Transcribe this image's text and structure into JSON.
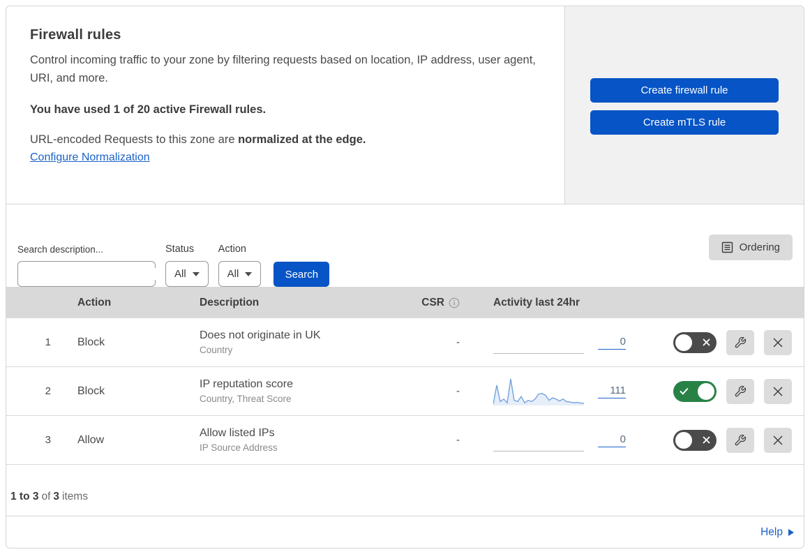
{
  "header": {
    "title": "Firewall rules",
    "description": "Control incoming traffic to your zone by filtering requests based on location, IP address, user agent, URI, and more.",
    "usage_bold": "You have used 1 of 20 active Firewall rules.",
    "normalization_prefix": "URL-encoded Requests to this zone are ",
    "normalization_bold": "normalized at the edge.",
    "normalization_link": "Configure Normalization",
    "create_firewall_button": "Create firewall rule",
    "create_mtls_button": "Create mTLS rule"
  },
  "filters": {
    "search_label": "Search description...",
    "search_value": "",
    "status_label": "Status",
    "status_value": "All",
    "action_label": "Action",
    "action_value": "All",
    "search_button": "Search",
    "ordering_button": "Ordering"
  },
  "table": {
    "columns": {
      "action": "Action",
      "description": "Description",
      "csr": "CSR",
      "activity": "Activity last 24hr"
    },
    "rows": [
      {
        "number": "1",
        "action": "Block",
        "description": "Does not originate in UK",
        "criteria": "Country",
        "csr": "-",
        "activity_count": "0",
        "enabled": false,
        "sparkline": []
      },
      {
        "number": "2",
        "action": "Block",
        "description": "IP reputation score",
        "criteria": "Country, Threat Score",
        "csr": "-",
        "activity_count": "111",
        "enabled": true,
        "sparkline": [
          0,
          75,
          10,
          20,
          5,
          100,
          15,
          10,
          30,
          5,
          15,
          10,
          20,
          40,
          42,
          35,
          15,
          25,
          20,
          12,
          20,
          10,
          8,
          5,
          7,
          4,
          3
        ]
      },
      {
        "number": "3",
        "action": "Allow",
        "description": "Allow listed IPs",
        "criteria": "IP Source Address",
        "csr": "-",
        "activity_count": "0",
        "enabled": false,
        "sparkline": []
      }
    ]
  },
  "footer": {
    "range_bold": "1 to 3",
    "of_text": "of",
    "total_bold": "3",
    "items_text": "items",
    "help_label": "Help"
  },
  "colors": {
    "brand_blue": "#0654c5",
    "link_blue": "#1b62c8",
    "toggle_on_green": "#288246",
    "toggle_off_gray": "#4a4a4a",
    "table_header_gray": "#d9d9d9",
    "panel_gray": "#f1f1f1",
    "sparkline_blue": "#74a3e0"
  }
}
